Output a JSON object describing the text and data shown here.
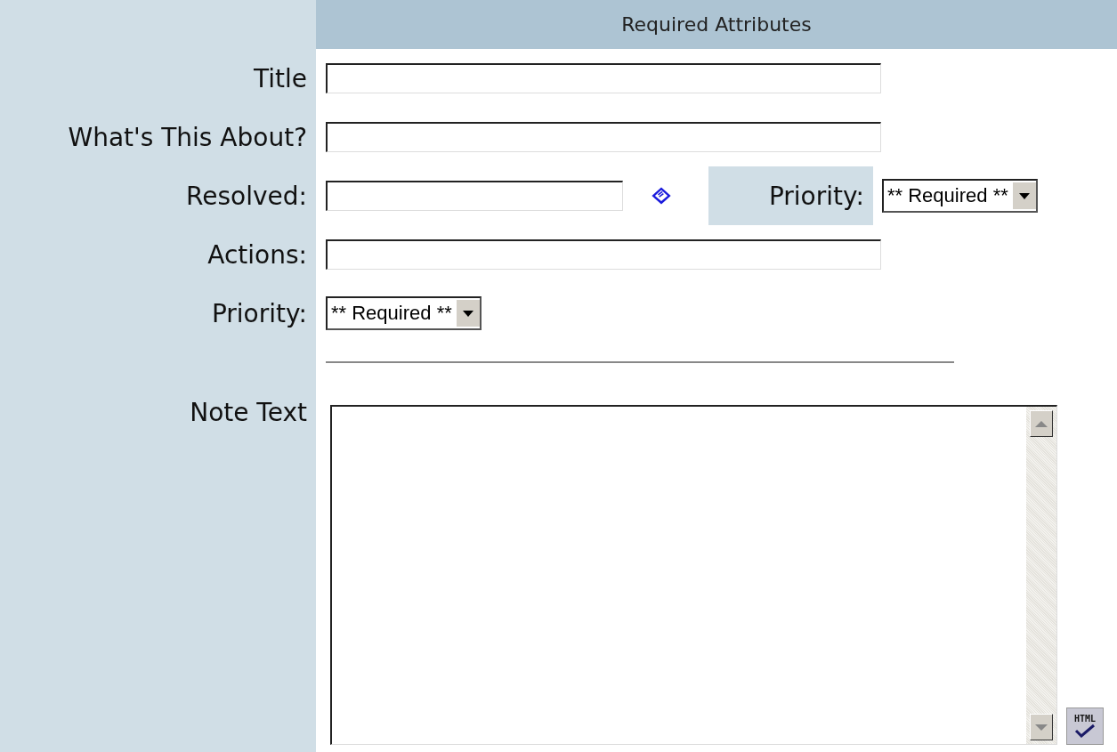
{
  "header": "Required Attributes",
  "fields": [
    {
      "kind": "text",
      "label": "Title"
    },
    {
      "kind": "text",
      "label": "What's This About?"
    },
    {
      "kind": "date",
      "label": "Resolved:",
      "side": {
        "label": "Priority:",
        "value": "** Required **"
      }
    },
    {
      "kind": "text",
      "label": "Actions:"
    },
    {
      "kind": "select",
      "label": "Priority:",
      "value": "** Required **"
    }
  ],
  "note": {
    "label": "Note Text"
  },
  "html_button": "HTML"
}
